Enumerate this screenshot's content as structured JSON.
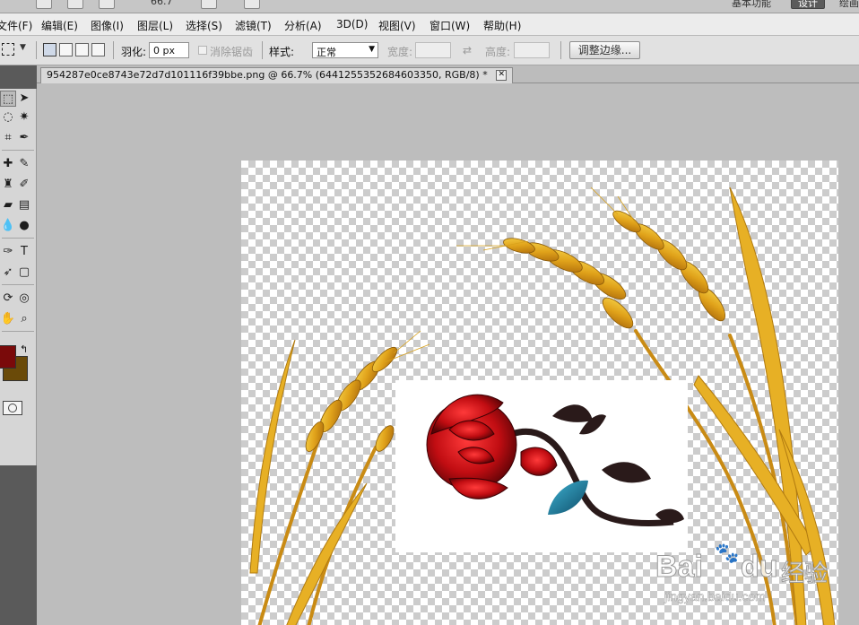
{
  "appbar": {
    "zoom": "66.7",
    "workspace_basic": "基本功能",
    "workspace_design": "设计",
    "workspace_paint": "绘画"
  },
  "menu": [
    "文件(F)",
    "编辑(E)",
    "图像(I)",
    "图层(L)",
    "选择(S)",
    "滤镜(T)",
    "分析(A)",
    "3D(D)",
    "视图(V)",
    "窗口(W)",
    "帮助(H)"
  ],
  "options": {
    "feather_label": "羽化:",
    "feather_value": "0 px",
    "antialias_label": "消除锯齿",
    "style_label": "样式:",
    "style_value": "正常",
    "width_label": "宽度:",
    "height_label": "高度:",
    "refine_edge": "调整边缘..."
  },
  "document": {
    "tab_title": "954287e0ce8743e72d7d101116f39bbe.png @ 66.7% (6441255352684603350, RGB/8) *"
  },
  "tools": [
    "marquee-icon",
    "move-icon",
    "lasso-icon",
    "magic-wand-icon",
    "crop-icon",
    "eyedropper-icon",
    "healing-icon",
    "brush-icon",
    "clone-stamp-icon",
    "history-brush-icon",
    "eraser-icon",
    "gradient-icon",
    "blur-icon",
    "dodge-icon",
    "pen-icon",
    "type-icon",
    "path-select-icon",
    "shape-icon",
    "3d-rotate-icon",
    "3d-orbit-icon",
    "hand-icon",
    "zoom-icon"
  ],
  "colors": {
    "foreground": "#7a0a0a",
    "background": "#6a4a08",
    "accent": "#5b5b5b"
  },
  "watermark": {
    "brand_bai": "Bai",
    "brand_du": "du",
    "brand_jingyan": "经验",
    "url": "jingyan.baidu.com"
  }
}
